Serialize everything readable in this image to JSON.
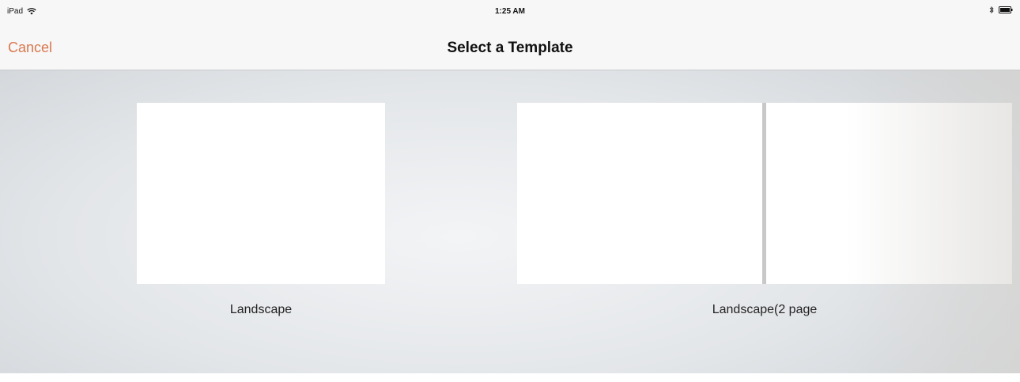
{
  "status_bar": {
    "device": "iPad",
    "time": "1:25 AM"
  },
  "nav_bar": {
    "cancel_label": "Cancel",
    "title": "Select a Template"
  },
  "templates": [
    {
      "label": "Landscape"
    },
    {
      "label": "Landscape(2 page"
    }
  ],
  "colors": {
    "accent": "#d9784f",
    "nav_background": "#f7f7f7",
    "content_background": "#e3e6e9"
  },
  "icons": {
    "status_left": "wifi-icon",
    "status_right": [
      "bluetooth-icon",
      "battery-icon"
    ]
  }
}
